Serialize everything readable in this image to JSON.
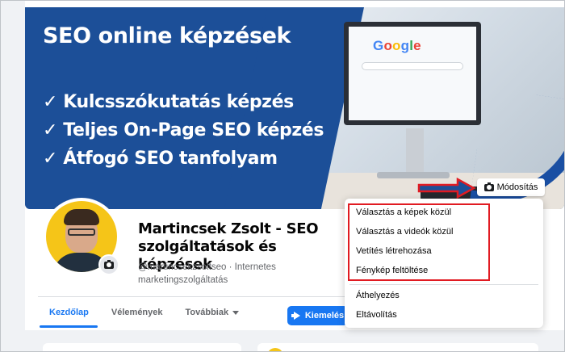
{
  "cover": {
    "title": "SEO online képzések",
    "list": [
      "✓ Kulcsszókutatás képzés",
      "✓ Teljes On-Page SEO képzés",
      "✓ Átfogó SEO tanfolyam"
    ],
    "google_logo_letters": [
      "G",
      "o",
      "o",
      "g",
      "l",
      "e"
    ],
    "google_logo_colors": [
      "#4285f4",
      "#ea4335",
      "#fbbc05",
      "#4285f4",
      "#34a853",
      "#ea4335"
    ],
    "edit_button_label": "Módosítás"
  },
  "profile": {
    "name": "Martincsek Zsolt - SEO szolgáltatások és képzések",
    "handle_line": "@martincsekzsoltseo · Internetes marketingszolgáltatás"
  },
  "nav": {
    "tabs": [
      {
        "label": "Kezdőlap",
        "active": true
      },
      {
        "label": "Vélemények",
        "active": false
      },
      {
        "label": "Továbbiak",
        "active": false
      }
    ],
    "promote_label": "Kiemelés"
  },
  "menu": {
    "items": [
      "Választás a képek közül",
      "Választás a videók közül",
      "Vetítés létrehozása",
      "Fénykép feltöltése"
    ],
    "secondary_items": [
      "Áthelyezés",
      "Eltávolítás"
    ]
  },
  "colors": {
    "brand_blue": "#1877f2",
    "cover_blue": "#1c4f98",
    "highlight_red": "#e11b22"
  },
  "icons": {
    "camera": "camera-icon",
    "megaphone": "megaphone-icon",
    "caret": "chevron-down-icon"
  }
}
